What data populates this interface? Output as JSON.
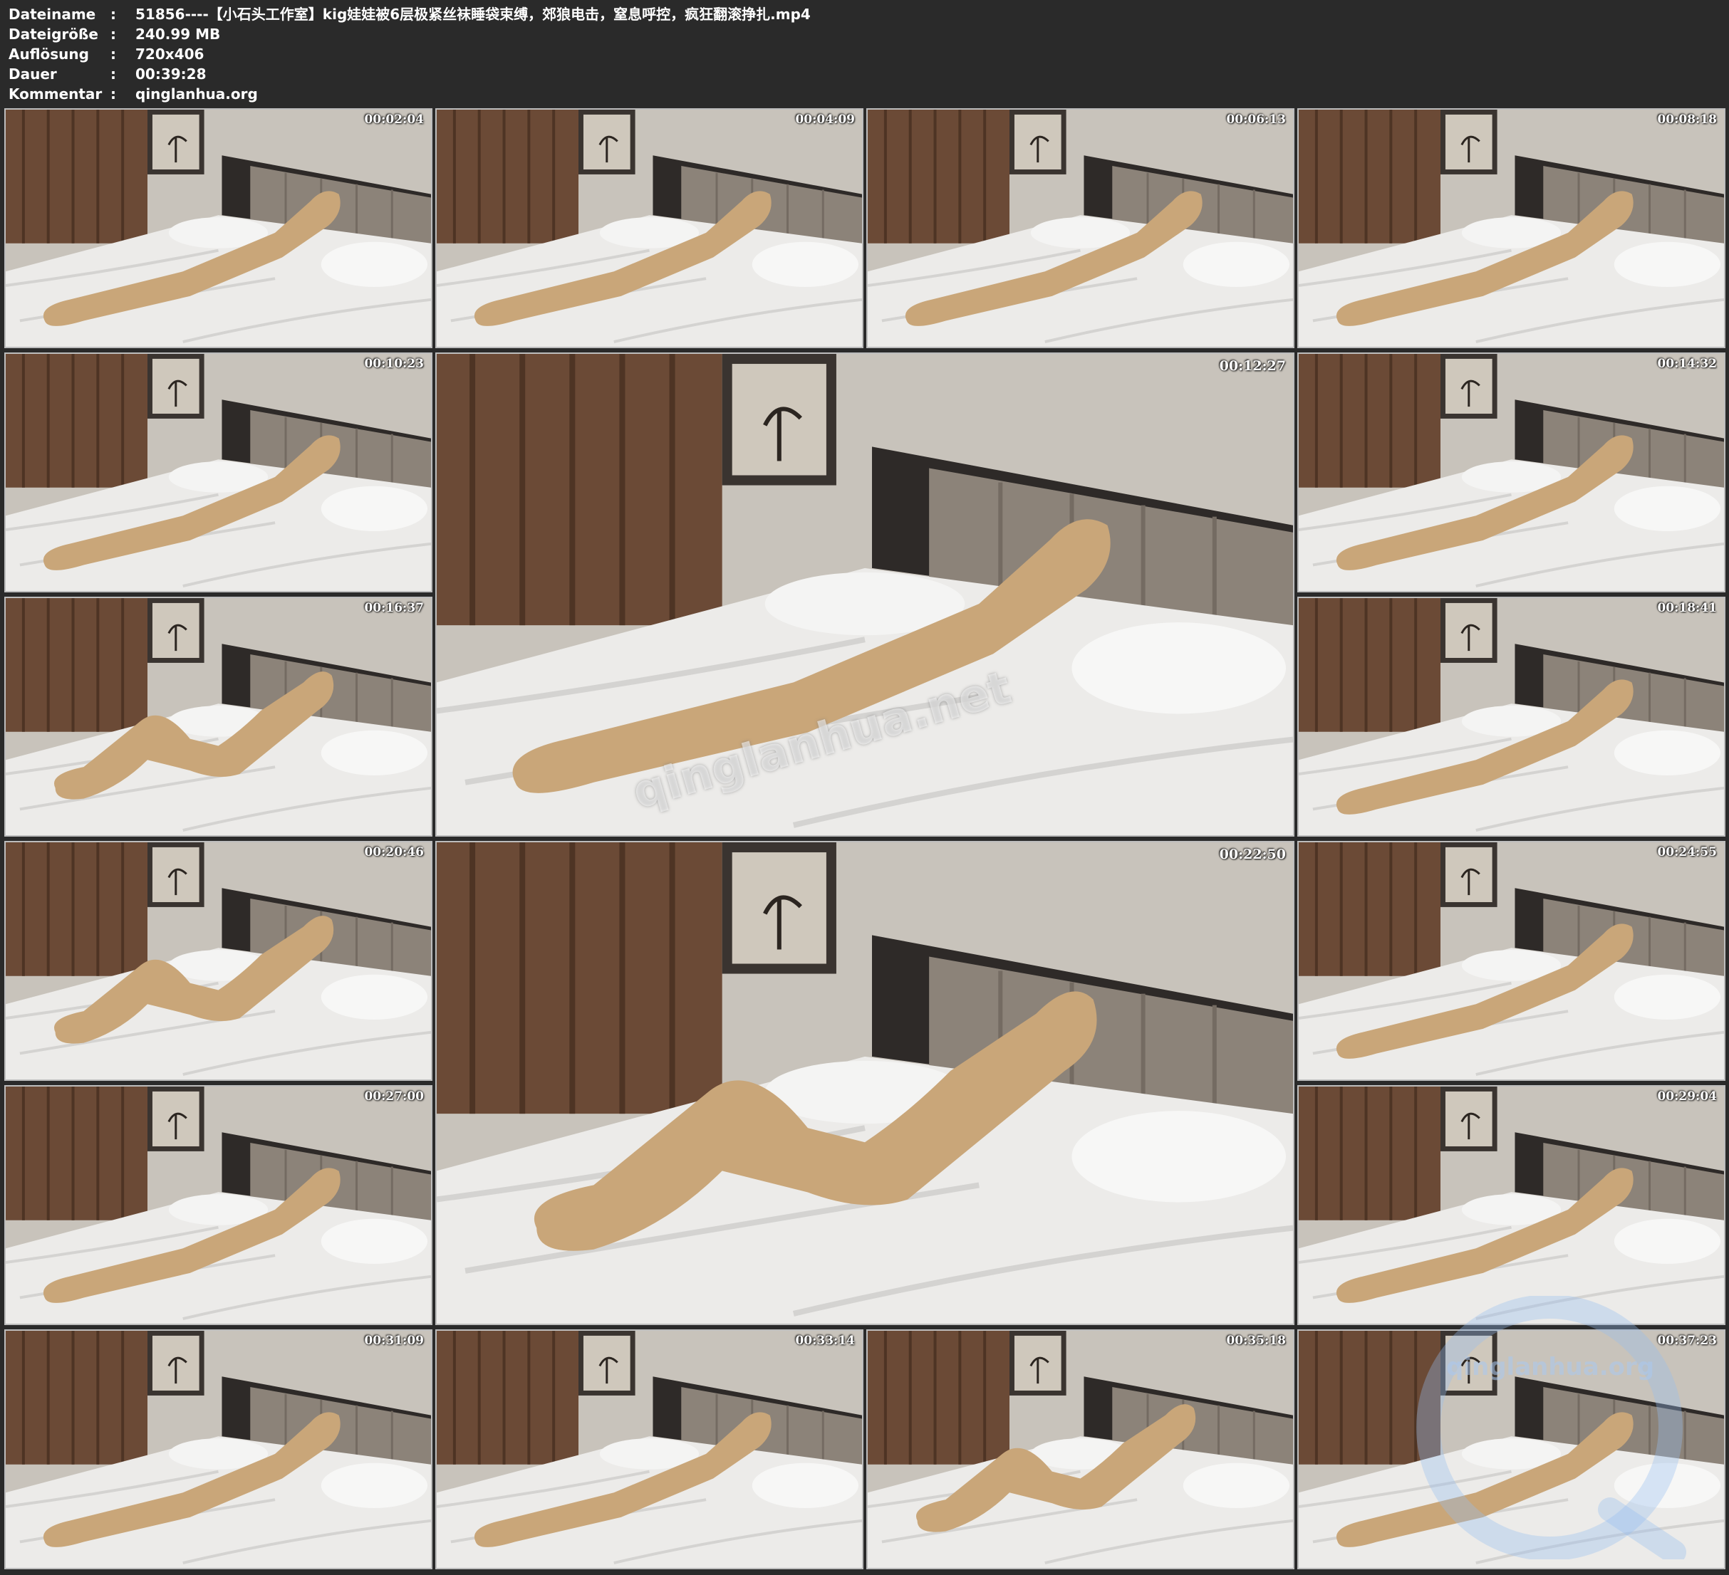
{
  "info": [
    {
      "key": "Dateiname",
      "value": "51856----【小石头工作室】kig娃娃被6层极紧丝袜睡袋束缚，郊狼电击，窒息呼控，疯狂翻滚挣扎.mp4"
    },
    {
      "key": "Dateigröße",
      "value": "240.99 MB"
    },
    {
      "key": "Auflösung",
      "value": "720x406"
    },
    {
      "key": "Dauer",
      "value": "00:39:28"
    },
    {
      "key": "Kommentar",
      "value": "qinglanhua.org"
    }
  ],
  "separator": ":",
  "thumbnails": [
    {
      "time": "00:02:04",
      "pose": "straight"
    },
    {
      "time": "00:04:09",
      "pose": "straight"
    },
    {
      "time": "00:06:13",
      "pose": "straight"
    },
    {
      "time": "00:08:18",
      "pose": "straight"
    },
    {
      "time": "00:10:23",
      "pose": "straight"
    },
    {
      "time": "00:12:27",
      "pose": "straight"
    },
    {
      "time": "00:14:32",
      "pose": "straight"
    },
    {
      "time": "00:16:37",
      "pose": "bent"
    },
    {
      "time": "00:18:41",
      "pose": "straight"
    },
    {
      "time": "00:20:46",
      "pose": "bent"
    },
    {
      "time": "00:22:50",
      "pose": "bent"
    },
    {
      "time": "00:24:55",
      "pose": "straight"
    },
    {
      "time": "00:27:00",
      "pose": "straight"
    },
    {
      "time": "00:29:04",
      "pose": "straight"
    },
    {
      "time": "00:31:09",
      "pose": "straight"
    },
    {
      "time": "00:33:14",
      "pose": "straight"
    },
    {
      "time": "00:35:18",
      "pose": "bent"
    },
    {
      "time": "00:37:23",
      "pose": "straight"
    }
  ],
  "watermarks": {
    "center": "qinglanhua.net",
    "corner": "qinglanhua.org"
  }
}
